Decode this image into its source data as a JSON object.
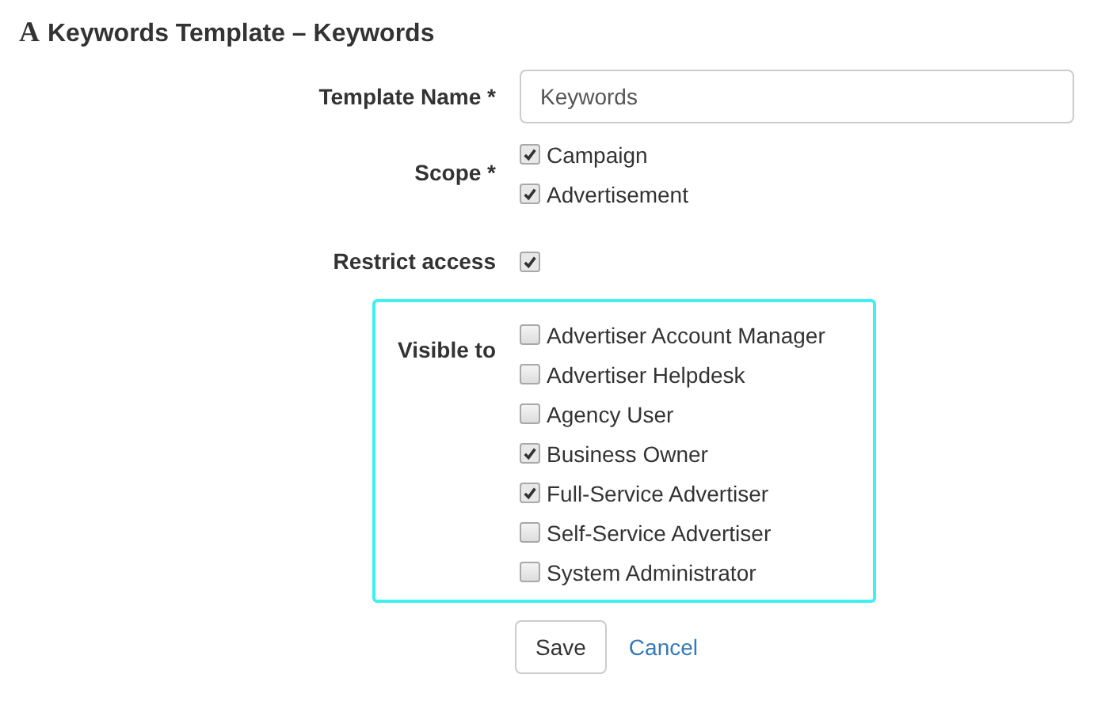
{
  "title": {
    "icon": "A",
    "text": "Keywords Template – Keywords"
  },
  "template_name": {
    "label": "Template Name *",
    "value": "Keywords"
  },
  "scope": {
    "label": "Scope *",
    "options": [
      {
        "label": "Campaign",
        "checked": true
      },
      {
        "label": "Advertisement",
        "checked": true
      }
    ]
  },
  "restrict_access": {
    "label": "Restrict access",
    "checked": true
  },
  "visible_to": {
    "label": "Visible to",
    "options": [
      {
        "label": "Advertiser Account Manager",
        "checked": false
      },
      {
        "label": "Advertiser Helpdesk",
        "checked": false
      },
      {
        "label": "Agency User",
        "checked": false
      },
      {
        "label": "Business Owner",
        "checked": true
      },
      {
        "label": "Full-Service Advertiser",
        "checked": true
      },
      {
        "label": "Self-Service Advertiser",
        "checked": false
      },
      {
        "label": "System Administrator",
        "checked": false
      }
    ]
  },
  "buttons": {
    "save": "Save",
    "cancel": "Cancel"
  }
}
